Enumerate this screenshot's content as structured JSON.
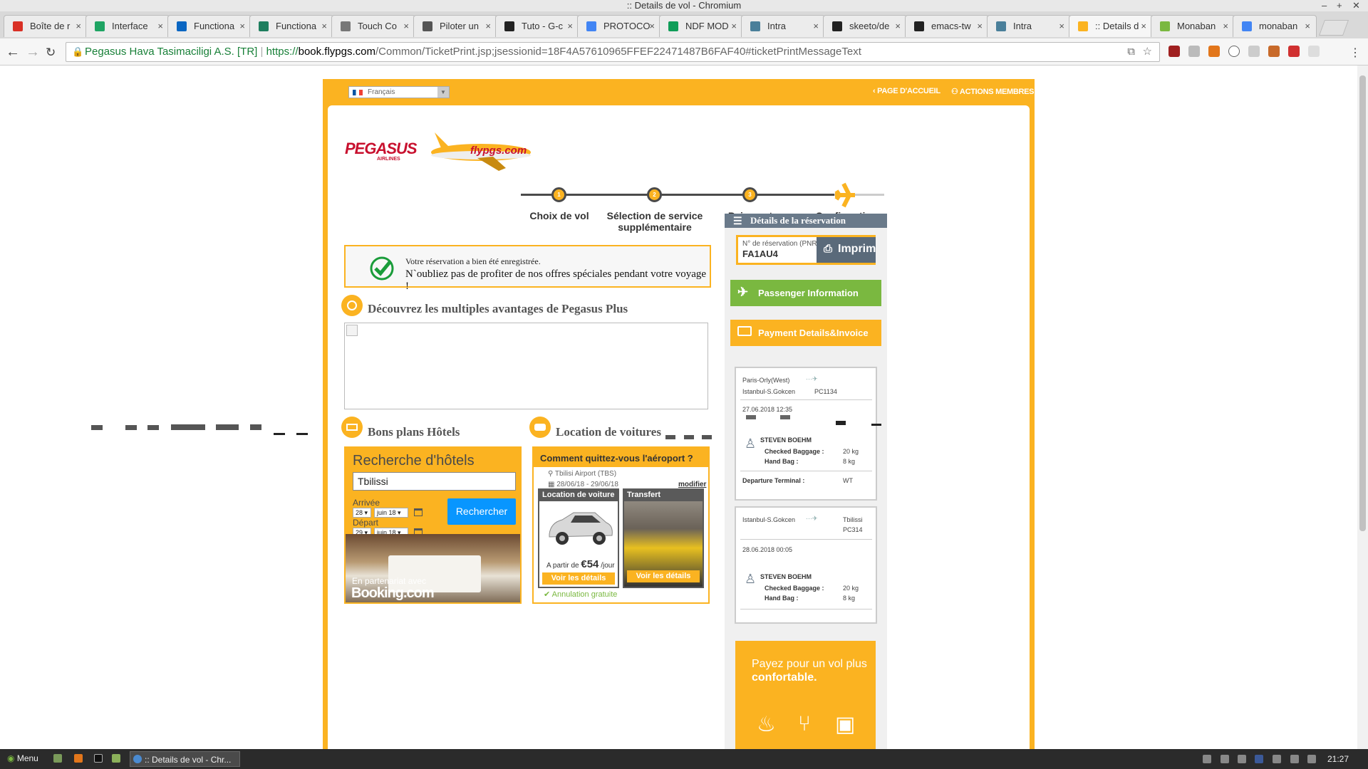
{
  "window": {
    "title": ":: Details de vol - Chromium"
  },
  "tabs": [
    {
      "label": "Boîte de r",
      "color": "#d93025"
    },
    {
      "label": "Interface",
      "color": "#1fa463"
    },
    {
      "label": "Functiona",
      "color": "#0a66c2"
    },
    {
      "label": "Functiona",
      "color": "#1e7e5e"
    },
    {
      "label": "Touch Co",
      "color": "#777777"
    },
    {
      "label": "Piloter un",
      "color": "#555555"
    },
    {
      "label": "Tuto - G-c",
      "color": "#222222"
    },
    {
      "label": "PROTOCO",
      "color": "#4285f4"
    },
    {
      "label": "NDF MOD",
      "color": "#0f9d58"
    },
    {
      "label": "Intra",
      "color": "#4a7f9a"
    },
    {
      "label": "skeeto/de",
      "color": "#222222"
    },
    {
      "label": "emacs-tw",
      "color": "#222222"
    },
    {
      "label": "Intra",
      "color": "#4a7f9a"
    },
    {
      "label": ":: Details d",
      "color": "#fbb321"
    },
    {
      "label": "Monaban",
      "color": "#7ab840"
    },
    {
      "label": "monaban",
      "color": "#4285f4"
    }
  ],
  "address": {
    "org": "Pegasus Hava Tasimaciligi A.S. [TR]",
    "scheme": "https://",
    "host": "book.flypgs.com",
    "path": "/Common/TicketPrint.jsp;jsessionid=18F4A57610965FFEF22471487B6FAF40#ticketPrintMessageText"
  },
  "top": {
    "language": "Français",
    "home_link": "PAGE D'ACCUEIL",
    "members_link": "ACTIONS MEMBRES"
  },
  "logo": {
    "brand": "PEGASUS",
    "sub": "AIRLINES",
    "site": "flypgs.com"
  },
  "steps": [
    {
      "num": "1",
      "label": "Choix de vol"
    },
    {
      "num": "2",
      "label": "Sélection de service supplémentaire"
    },
    {
      "num": "3",
      "label": "Paiement"
    },
    {
      "num": "",
      "label": "Confirmation"
    }
  ],
  "confirmation": {
    "line1": "Votre réservation a bien été enregistrée.",
    "line2": "N`oubliez pas de profiter de nos offres spéciales pendant votre voyage !"
  },
  "plus_title": "Découvrez les multiples avantages de Pegasus Plus",
  "hotels": {
    "section_title": "Bons plans Hôtels",
    "box_title": "Recherche d'hôtels",
    "city": "Tbilissi",
    "arrival_label": "Arrivée",
    "arrival_day": "28",
    "arrival_month": "juin 18",
    "departure_label": "Départ",
    "departure_day": "29",
    "departure_month": "juin 18",
    "search_button": "Rechercher",
    "partner": "En partenariat avec",
    "partner_brand": "Booking.com"
  },
  "cars": {
    "section_title": "Location de voitures",
    "question": "Comment quittez-vous l'aéroport ?",
    "airport": "Tbilisi Airport (TBS)",
    "dates": "28/06/18 - 29/06/18",
    "modify": "modifier",
    "rental_title": "Location de voiture",
    "price_prefix": "A partir de",
    "price": "€54",
    "price_suffix": "/jour",
    "rental_button": "Voir les détails",
    "transfer_title": "Transfert",
    "transfer_button": "Voir les détails",
    "free_cancel": "Annulation gratuite"
  },
  "reservation": {
    "header": "Détails de la réservation",
    "pnr_label": "N° de réservation (PNR)",
    "pnr": "FA1AU4",
    "print_button": "Imprimez",
    "passenger_button": "Passenger Information",
    "payment_button": "Payment Details&Invoice"
  },
  "flights": [
    {
      "from": "Paris-Orly(West)",
      "to": "Istanbul-S.Gokcen",
      "flight": "PC1134",
      "datetime": "27.06.2018 12:35",
      "passenger": "STEVEN BOEHM",
      "checked_label": "Checked Baggage :",
      "checked": "20 kg",
      "hand_label": "Hand Bag :",
      "hand": "8 kg",
      "terminal_label": "Departure Terminal :",
      "terminal": "WT"
    },
    {
      "from": "Istanbul-S.Gokcen",
      "to": "Tbilissi",
      "flight": "PC314",
      "datetime": "28.06.2018 00:05",
      "passenger": "STEVEN BOEHM",
      "checked_label": "Checked Baggage :",
      "checked": "20 kg",
      "hand_label": "Hand Bag :",
      "hand": "8 kg"
    }
  ],
  "promo": {
    "line1": "Payez pour un vol plus",
    "line2": "confortable."
  },
  "taskbar": {
    "menu": "Menu",
    "task": ":: Details de vol - Chr...",
    "clock": "21:27"
  },
  "colors": {
    "brand_yellow": "#fbb321",
    "green_button": "#7ab840",
    "search_blue": "#0896ff"
  }
}
